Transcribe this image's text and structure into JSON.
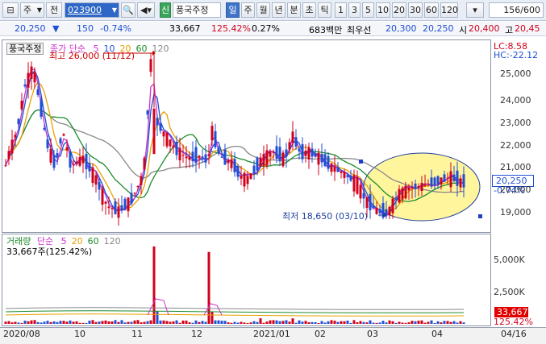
{
  "toolbar": {
    "market_label": "주",
    "market_scope": "전",
    "stock_code": "023900",
    "stock_badge": "신",
    "stock_name": "풍국주정",
    "periods": [
      "일",
      "주",
      "월",
      "년",
      "분",
      "초",
      "틱"
    ],
    "selected_period": "일",
    "intervals": [
      "1",
      "3",
      "5",
      "10",
      "20",
      "30",
      "60",
      "120"
    ],
    "count_value": "156",
    "count_total": "/600"
  },
  "info": {
    "price": "20,250",
    "change": "150",
    "change_pct": "-0.74%",
    "volume": "33,667",
    "volume_pct": "125.42%",
    "turnover_pct": "0.27%",
    "trade_value": "683백만",
    "priority_label": "최우선",
    "ask": "20,300",
    "bid": "20,250",
    "open_label": "시",
    "open": "20,400",
    "high_label": "고",
    "high": "20,45"
  },
  "price_panel": {
    "title": "풍국주정",
    "ma_label": "종가 단순",
    "ma_periods": [
      "5",
      "10",
      "20",
      "60",
      "120"
    ],
    "lc": "LC:8.58",
    "hc": "HC:-22.12",
    "high_annotation": "최고 26,000 (11/12)",
    "low_annotation": "최저 18,650 (03/10)",
    "y_ticks": [
      "25,000",
      "24,000",
      "23,000",
      "22,000",
      "21,000",
      "20,000",
      "19,000"
    ],
    "current_price_tag": "20,250",
    "current_pct_tag": "-0.74%"
  },
  "volume_panel": {
    "title": "거래량",
    "ma_label": "단순",
    "ma_periods": [
      "5",
      "20",
      "60",
      "120"
    ],
    "current": "33,667주(125.42%)",
    "y_ticks": [
      "5,000K",
      "2,500K"
    ],
    "current_tag": "33,667",
    "current_pct_tag": "125.42%"
  },
  "x_axis": [
    "2020/08",
    "10",
    "11",
    "12",
    "2021/01",
    "02",
    "03",
    "04",
    "04/16"
  ],
  "colors": {
    "up": "#d0021b",
    "down": "#1f4fd6",
    "ma5": "#cc33cc",
    "ma10": "#1f4fd6",
    "ma20": "#e8a000",
    "ma60": "#1c8c2c",
    "ma120": "#888888",
    "highlight": "#fff59d"
  },
  "chart_data": {
    "type": "candlestick",
    "x": [
      "2020/08",
      "10",
      "11",
      "12",
      "2021/01",
      "02",
      "03",
      "04"
    ],
    "price_high": 26000,
    "price_low": 18650,
    "last_close": 20250,
    "ylim": [
      18500,
      26000
    ],
    "volume_ylim": [
      0,
      6000000
    ],
    "grid": false
  }
}
